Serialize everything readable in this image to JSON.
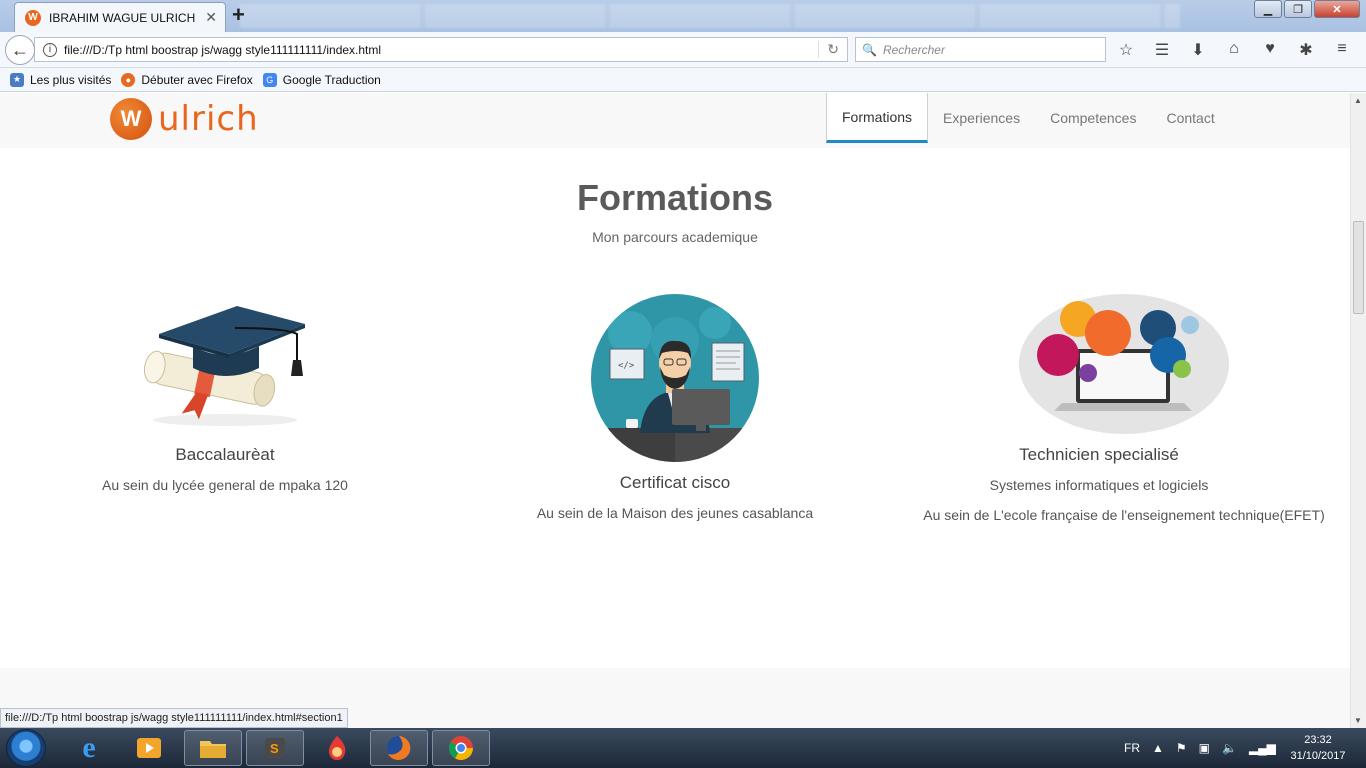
{
  "browser": {
    "tab_title": "IBRAHIM WAGUE ULRICH",
    "tab_favicon_letter": "W",
    "url": "file:///D:/Tp html boostrap js/wagg style111111111/index.html",
    "search_placeholder": "Rechercher",
    "bookmarks": [
      {
        "label": "Les plus visités",
        "icon": "bookmark-folder-icon"
      },
      {
        "label": "Débuter avec Firefox",
        "icon": "firefox-icon"
      },
      {
        "label": "Google Traduction",
        "icon": "google-translate-icon"
      }
    ],
    "status_url": "file:///D:/Tp html boostrap js/wagg style111111111/index.html#section1"
  },
  "site": {
    "logo_letter": "W",
    "logo_text": "ulrich",
    "nav": [
      {
        "label": "Formations",
        "active": true
      },
      {
        "label": "Experiences",
        "active": false
      },
      {
        "label": "Competences",
        "active": false
      },
      {
        "label": "Contact",
        "active": false
      }
    ],
    "section": {
      "title": "Formations",
      "subtitle": "Mon parcours academique",
      "cards": [
        {
          "title": "Baccalaurèat",
          "lines": [
            "Au sein du lycée general de mpaka 120"
          ],
          "image": "graduation-cap-diploma"
        },
        {
          "title": "Certificat cisco",
          "lines": [
            "Au sein de la Maison des jeunes casablanca"
          ],
          "image": "developer-at-computer"
        },
        {
          "title": "Technicien specialisé",
          "lines": [
            "Systemes informatiques et logiciels",
            "Au sein de L'ecole française de l'enseignement technique(EFET)"
          ],
          "image": "web-technologies-laptop"
        }
      ]
    }
  },
  "taskbar": {
    "language": "FR",
    "time": "23:32",
    "date": "31/10/2017"
  },
  "colors": {
    "accent": "#1e8bc3",
    "brand": "#e8661e"
  }
}
